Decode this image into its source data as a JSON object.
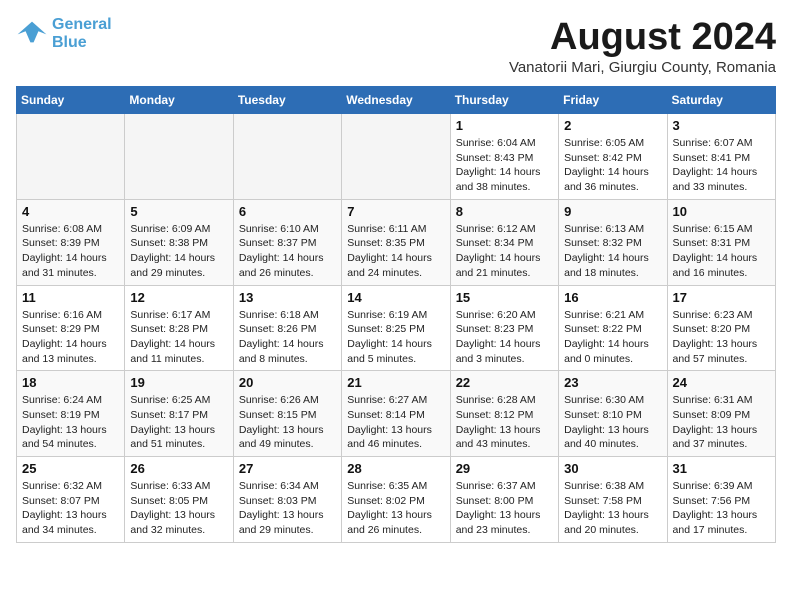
{
  "header": {
    "logo_line1": "General",
    "logo_line2": "Blue",
    "month_title": "August 2024",
    "subtitle": "Vanatorii Mari, Giurgiu County, Romania"
  },
  "weekdays": [
    "Sunday",
    "Monday",
    "Tuesday",
    "Wednesday",
    "Thursday",
    "Friday",
    "Saturday"
  ],
  "weeks": [
    [
      {
        "day": "",
        "info": ""
      },
      {
        "day": "",
        "info": ""
      },
      {
        "day": "",
        "info": ""
      },
      {
        "day": "",
        "info": ""
      },
      {
        "day": "1",
        "info": "Sunrise: 6:04 AM\nSunset: 8:43 PM\nDaylight: 14 hours\nand 38 minutes."
      },
      {
        "day": "2",
        "info": "Sunrise: 6:05 AM\nSunset: 8:42 PM\nDaylight: 14 hours\nand 36 minutes."
      },
      {
        "day": "3",
        "info": "Sunrise: 6:07 AM\nSunset: 8:41 PM\nDaylight: 14 hours\nand 33 minutes."
      }
    ],
    [
      {
        "day": "4",
        "info": "Sunrise: 6:08 AM\nSunset: 8:39 PM\nDaylight: 14 hours\nand 31 minutes."
      },
      {
        "day": "5",
        "info": "Sunrise: 6:09 AM\nSunset: 8:38 PM\nDaylight: 14 hours\nand 29 minutes."
      },
      {
        "day": "6",
        "info": "Sunrise: 6:10 AM\nSunset: 8:37 PM\nDaylight: 14 hours\nand 26 minutes."
      },
      {
        "day": "7",
        "info": "Sunrise: 6:11 AM\nSunset: 8:35 PM\nDaylight: 14 hours\nand 24 minutes."
      },
      {
        "day": "8",
        "info": "Sunrise: 6:12 AM\nSunset: 8:34 PM\nDaylight: 14 hours\nand 21 minutes."
      },
      {
        "day": "9",
        "info": "Sunrise: 6:13 AM\nSunset: 8:32 PM\nDaylight: 14 hours\nand 18 minutes."
      },
      {
        "day": "10",
        "info": "Sunrise: 6:15 AM\nSunset: 8:31 PM\nDaylight: 14 hours\nand 16 minutes."
      }
    ],
    [
      {
        "day": "11",
        "info": "Sunrise: 6:16 AM\nSunset: 8:29 PM\nDaylight: 14 hours\nand 13 minutes."
      },
      {
        "day": "12",
        "info": "Sunrise: 6:17 AM\nSunset: 8:28 PM\nDaylight: 14 hours\nand 11 minutes."
      },
      {
        "day": "13",
        "info": "Sunrise: 6:18 AM\nSunset: 8:26 PM\nDaylight: 14 hours\nand 8 minutes."
      },
      {
        "day": "14",
        "info": "Sunrise: 6:19 AM\nSunset: 8:25 PM\nDaylight: 14 hours\nand 5 minutes."
      },
      {
        "day": "15",
        "info": "Sunrise: 6:20 AM\nSunset: 8:23 PM\nDaylight: 14 hours\nand 3 minutes."
      },
      {
        "day": "16",
        "info": "Sunrise: 6:21 AM\nSunset: 8:22 PM\nDaylight: 14 hours\nand 0 minutes."
      },
      {
        "day": "17",
        "info": "Sunrise: 6:23 AM\nSunset: 8:20 PM\nDaylight: 13 hours\nand 57 minutes."
      }
    ],
    [
      {
        "day": "18",
        "info": "Sunrise: 6:24 AM\nSunset: 8:19 PM\nDaylight: 13 hours\nand 54 minutes."
      },
      {
        "day": "19",
        "info": "Sunrise: 6:25 AM\nSunset: 8:17 PM\nDaylight: 13 hours\nand 51 minutes."
      },
      {
        "day": "20",
        "info": "Sunrise: 6:26 AM\nSunset: 8:15 PM\nDaylight: 13 hours\nand 49 minutes."
      },
      {
        "day": "21",
        "info": "Sunrise: 6:27 AM\nSunset: 8:14 PM\nDaylight: 13 hours\nand 46 minutes."
      },
      {
        "day": "22",
        "info": "Sunrise: 6:28 AM\nSunset: 8:12 PM\nDaylight: 13 hours\nand 43 minutes."
      },
      {
        "day": "23",
        "info": "Sunrise: 6:30 AM\nSunset: 8:10 PM\nDaylight: 13 hours\nand 40 minutes."
      },
      {
        "day": "24",
        "info": "Sunrise: 6:31 AM\nSunset: 8:09 PM\nDaylight: 13 hours\nand 37 minutes."
      }
    ],
    [
      {
        "day": "25",
        "info": "Sunrise: 6:32 AM\nSunset: 8:07 PM\nDaylight: 13 hours\nand 34 minutes."
      },
      {
        "day": "26",
        "info": "Sunrise: 6:33 AM\nSunset: 8:05 PM\nDaylight: 13 hours\nand 32 minutes."
      },
      {
        "day": "27",
        "info": "Sunrise: 6:34 AM\nSunset: 8:03 PM\nDaylight: 13 hours\nand 29 minutes."
      },
      {
        "day": "28",
        "info": "Sunrise: 6:35 AM\nSunset: 8:02 PM\nDaylight: 13 hours\nand 26 minutes."
      },
      {
        "day": "29",
        "info": "Sunrise: 6:37 AM\nSunset: 8:00 PM\nDaylight: 13 hours\nand 23 minutes."
      },
      {
        "day": "30",
        "info": "Sunrise: 6:38 AM\nSunset: 7:58 PM\nDaylight: 13 hours\nand 20 minutes."
      },
      {
        "day": "31",
        "info": "Sunrise: 6:39 AM\nSunset: 7:56 PM\nDaylight: 13 hours\nand 17 minutes."
      }
    ]
  ]
}
